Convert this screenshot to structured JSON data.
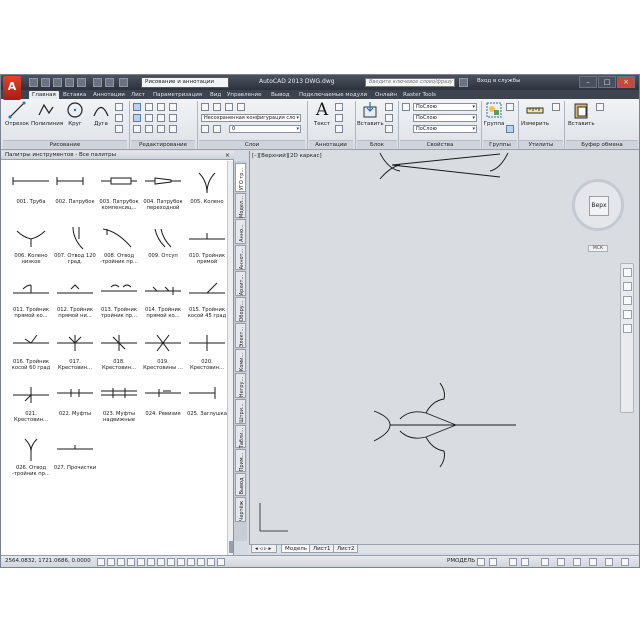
{
  "window": {
    "workspace": "Рисование и аннотации",
    "title": "AutoCAD 2013    DWG.dwg",
    "search_placeholder": "Введите ключевое слово/фразу",
    "signin": "Вход в службы"
  },
  "ribbon_tabs": [
    "Главная",
    "Вставка",
    "Аннотации",
    "Лист",
    "Параметризация",
    "Вид",
    "Управление",
    "Вывод",
    "Подключаемые модули",
    "Онлайн",
    "Raster Tools"
  ],
  "ribbon": {
    "draw": {
      "label": "Рисование",
      "tools": [
        "Отрезок",
        "Полилиния",
        "Круг",
        "Дуга"
      ]
    },
    "modify": {
      "label": "Редактирование"
    },
    "layers": {
      "label": "Слои",
      "layer_state": "Несохраненная конфигурация сло",
      "layer": "0"
    },
    "annotation": {
      "label": "Аннотации",
      "tool": "Текст"
    },
    "block": {
      "label": "Блок",
      "tool": "Вставить"
    },
    "properties": {
      "label": "Свойства",
      "color": "ПоСлою",
      "linetype": "ПоСлою",
      "lineweight": "ПоСлою"
    },
    "groups": {
      "label": "Группы",
      "tool": "Группа"
    },
    "utilities": {
      "label": "Утилиты",
      "tool": "Измерить"
    },
    "clipboard": {
      "label": "Буфер обмена",
      "tool": "Вставить"
    }
  },
  "palette": {
    "title": "Палитры инструментов - Все палитры",
    "tools": [
      "001. Труба",
      "002. Патрубок",
      "003. Патрубок компенсиц...",
      "004. Патрубок переходной",
      "005. Колено",
      "006. Колено низкое",
      "007. Отвод 120 град.",
      "008. Отвод -тройник пр...",
      "009. Отсуп",
      "010. Тройник прямой",
      "011. Тройник прямой ко...",
      "012. Тройник прямой ни...",
      "013. Тройник тройник пр...",
      "014. Тройник прямой ко...",
      "015. Тройник косой 45 град",
      "016. Тройник косой 60 град",
      "017. Крестовин...",
      "018. Крестовин...",
      "019. Крестовины ...",
      "020. Крестовин...",
      "021. Крестовин...",
      "022. Муфты",
      "023. Муфты надвижные",
      "024. Ревизия",
      "025. Заглушка",
      "026. Отвод -тройник пр...",
      "027. Прочистки"
    ]
  },
  "side_tabs": [
    "УГО тр...",
    "Модел...",
    "Анно...",
    "Аннот...",
    "Архит...",
    "Обору...",
    "Элект...",
    "Коми...",
    "Негру...",
    "Штри...",
    "Табли...",
    "Прим...",
    "Вывод",
    "Чертёж"
  ],
  "drawing": {
    "viewport_label": "[–][Верхний][2D каркас]",
    "viewcube_face": "Верх",
    "wcs": "МСК"
  },
  "layout_tabs": [
    "Модель",
    "Лист1",
    "Лист2"
  ],
  "status": {
    "coords": "2564.0832, 1721.0686, 0.0000",
    "model": "РМОДЕЛЬ"
  }
}
